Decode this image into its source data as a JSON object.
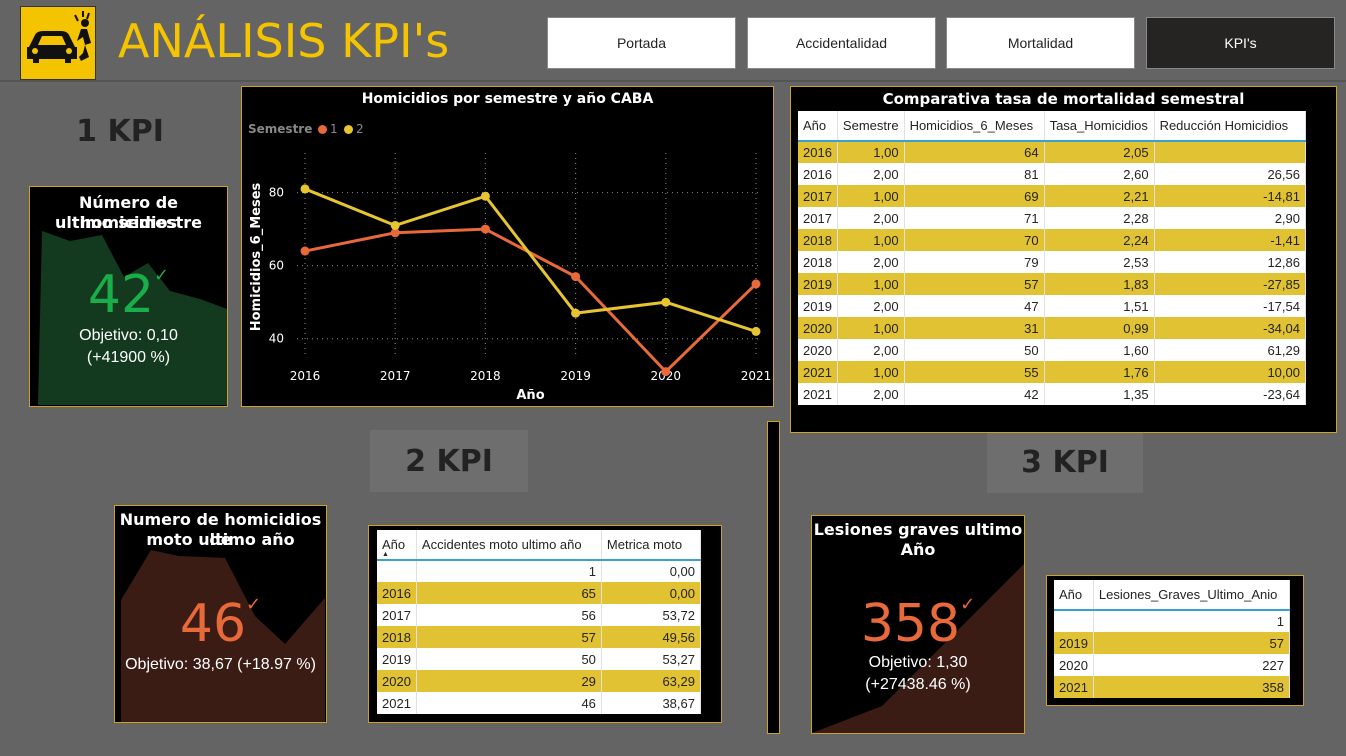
{
  "header": {
    "title": "ANÁLISIS KPI's",
    "nav": [
      "Portada",
      "Accidentalidad",
      "Mortalidad",
      "KPI's"
    ],
    "active_nav": "KPI's"
  },
  "sections": {
    "kpi1": "1 KPI",
    "kpi2": "2 KPI",
    "kpi3": "3 KPI"
  },
  "kpi_card_1": {
    "title_line1": "Número de homicidios",
    "title_line2": "ultimo semestre",
    "value": "42",
    "goal_line1": "Objetivo: 0,10",
    "goal_line2": "(+41900 %)",
    "color": "#1aae4a"
  },
  "kpi_card_2": {
    "title_line1": "Numero de homicidios de",
    "title_line2": "moto ultimo año",
    "value": "46",
    "goal_line1": "Objetivo: 38,67 (+18.97 %)",
    "color": "#e8693a"
  },
  "kpi_card_3": {
    "title_line1": "Lesiones graves ultimo",
    "title_line2": "Año",
    "value": "358",
    "goal_line1": "Objetivo: 1,30",
    "goal_line2": "(+27438.46 %)",
    "color": "#e8693a"
  },
  "chart_data": {
    "type": "line",
    "title": "Homicidios por semestre y año CABA",
    "legend_title": "Semestre",
    "xlabel": "Año",
    "ylabel": "Homicidios_6_Meses",
    "categories": [
      "2016",
      "2017",
      "2018",
      "2019",
      "2020",
      "2021"
    ],
    "yticks": [
      "40",
      "60",
      "80"
    ],
    "ylim": [
      35,
      87
    ],
    "series": [
      {
        "name": "1",
        "values": [
          64,
          69,
          70,
          57,
          31,
          55
        ],
        "color": "#e8693a"
      },
      {
        "name": "2",
        "values": [
          81,
          71,
          79,
          47,
          50,
          42
        ],
        "color": "#e6c530"
      }
    ]
  },
  "table_mortalidad": {
    "title": "Comparativa tasa de mortalidad semestral",
    "columns": [
      "Año",
      "Semestre",
      "Homicidios_6_Meses",
      "Tasa_Homicidios",
      "Reducción Homicidios"
    ],
    "rows": [
      [
        "2016",
        "1,00",
        "64",
        "2,05",
        ""
      ],
      [
        "2016",
        "2,00",
        "81",
        "2,60",
        "26,56"
      ],
      [
        "2017",
        "1,00",
        "69",
        "2,21",
        "-14,81"
      ],
      [
        "2017",
        "2,00",
        "71",
        "2,28",
        "2,90"
      ],
      [
        "2018",
        "1,00",
        "70",
        "2,24",
        "-1,41"
      ],
      [
        "2018",
        "2,00",
        "79",
        "2,53",
        "12,86"
      ],
      [
        "2019",
        "1,00",
        "57",
        "1,83",
        "-27,85"
      ],
      [
        "2019",
        "2,00",
        "47",
        "1,51",
        "-17,54"
      ],
      [
        "2020",
        "1,00",
        "31",
        "0,99",
        "-34,04"
      ],
      [
        "2020",
        "2,00",
        "50",
        "1,60",
        "61,29"
      ],
      [
        "2021",
        "1,00",
        "55",
        "1,76",
        "10,00"
      ],
      [
        "2021",
        "2,00",
        "42",
        "1,35",
        "-23,64"
      ]
    ]
  },
  "table_moto": {
    "columns": [
      "Año",
      "Accidentes moto ultimo año",
      "Metrica moto"
    ],
    "rows": [
      [
        "",
        "1",
        "0,00"
      ],
      [
        "2016",
        "65",
        "0,00"
      ],
      [
        "2017",
        "56",
        "53,72"
      ],
      [
        "2018",
        "57",
        "49,56"
      ],
      [
        "2019",
        "50",
        "53,27"
      ],
      [
        "2020",
        "29",
        "63,29"
      ],
      [
        "2021",
        "46",
        "38,67"
      ]
    ]
  },
  "table_lesiones": {
    "columns": [
      "Año",
      "Lesiones_Graves_Ultimo_Anio"
    ],
    "rows": [
      [
        "",
        "1"
      ],
      [
        "2019",
        "57"
      ],
      [
        "2020",
        "227"
      ],
      [
        "2021",
        "358"
      ]
    ]
  }
}
